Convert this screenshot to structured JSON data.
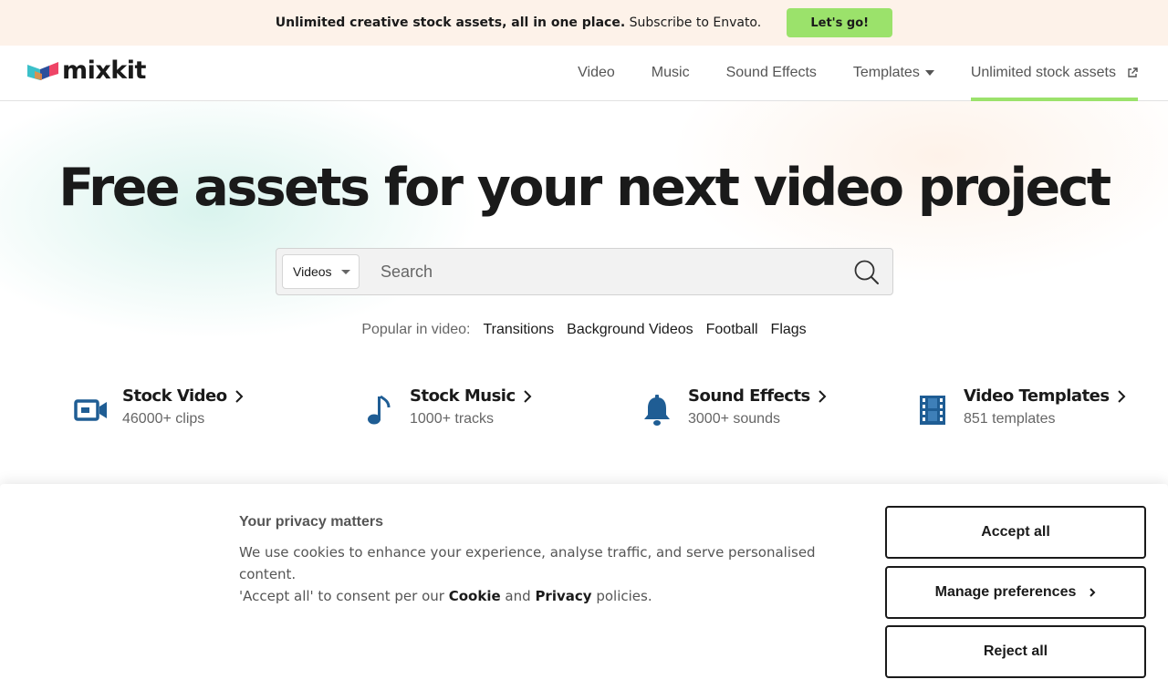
{
  "promo": {
    "text_bold": "Unlimited creative stock assets, all in one place.",
    "text_regular": "Subscribe to Envato.",
    "cta_label": "Let's go!",
    "cta_color": "#9be26b",
    "background": "#fdf2e9"
  },
  "header": {
    "logo_text": "mixkit",
    "nav": [
      {
        "label": "Video"
      },
      {
        "label": "Music"
      },
      {
        "label": "Sound Effects"
      },
      {
        "label": "Templates",
        "has_dropdown": true
      },
      {
        "label": "Unlimited stock assets",
        "external": true,
        "active": true
      }
    ]
  },
  "hero": {
    "title": "Free assets for your next video project",
    "search": {
      "category": "Videos",
      "placeholder": "Search",
      "value": ""
    },
    "popular": {
      "label": "Popular in video:",
      "links": [
        "Transitions",
        "Background Videos",
        "Football",
        "Flags"
      ]
    }
  },
  "categories": [
    {
      "title": "Stock Video",
      "subtitle": "46000+ clips",
      "icon": "video-camera-icon"
    },
    {
      "title": "Stock Music",
      "subtitle": "1000+ tracks",
      "icon": "music-note-icon"
    },
    {
      "title": "Sound Effects",
      "subtitle": "3000+ sounds",
      "icon": "bell-icon"
    },
    {
      "title": "Video Templates",
      "subtitle": "851 templates",
      "icon": "film-strip-icon"
    }
  ],
  "icon_color": "#1f5d94",
  "cookie": {
    "title": "Your privacy matters",
    "text_line1": "We use cookies to enhance your experience, analyse traffic, and serve personalised content.",
    "text_line2_prefix": "'Accept all' to consent per our",
    "cookie_link": "Cookie",
    "and_text": "and",
    "privacy_link": "Privacy",
    "text_line2_suffix": "policies.",
    "accept_label": "Accept all",
    "manage_label": "Manage preferences",
    "reject_label": "Reject all"
  }
}
